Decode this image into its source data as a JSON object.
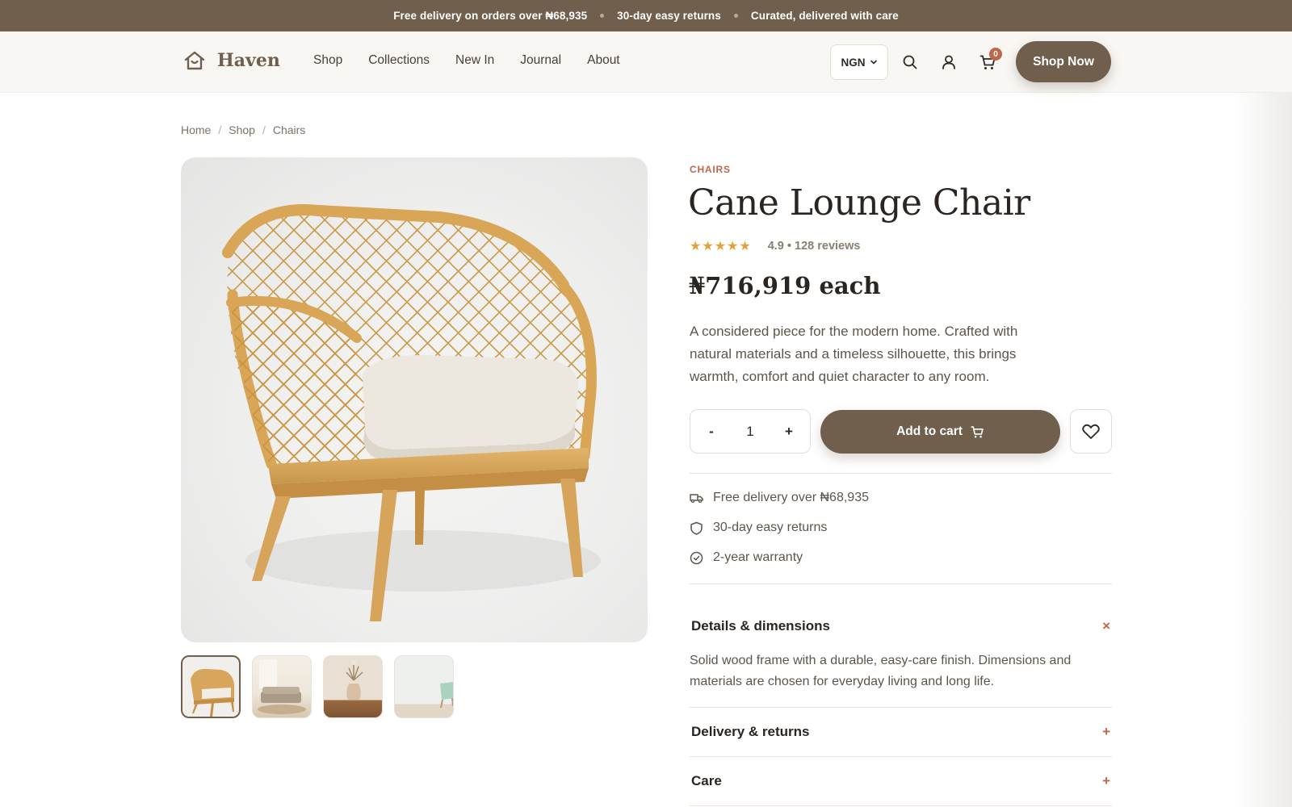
{
  "announcement": {
    "item1": "Free delivery on orders over ₦68,935",
    "item2": "30-day easy returns",
    "item3": "Curated, delivered with care"
  },
  "header": {
    "logo_text": "Haven",
    "nav": [
      "Shop",
      "Collections",
      "New In",
      "Journal",
      "About"
    ],
    "currency": "NGN",
    "cart_count": "0",
    "cta": "Shop Now"
  },
  "breadcrumb": [
    "Home",
    "Shop",
    "Chairs"
  ],
  "gallery": {
    "thumbnails": [
      "chair",
      "living-room",
      "vase",
      "mint-chair"
    ],
    "active_index": 0
  },
  "product": {
    "category": "CHAIRS",
    "title": "Cane Lounge Chair",
    "stars": "★★★★★",
    "rating_text": "4.9 • 128 reviews",
    "price": "₦716,919 each",
    "description": "A considered piece for the modern home. Crafted with natural materials and a timeless silhouette, this brings warmth, comfort and quiet character to any room.",
    "quantity": "1",
    "qty_minus": "-",
    "qty_plus": "+",
    "add_to_cart": "Add to cart"
  },
  "perks": [
    {
      "icon": "truck-icon",
      "text": "Free delivery over ₦68,935"
    },
    {
      "icon": "shield-icon",
      "text": "30-day easy returns"
    },
    {
      "icon": "check-circle-icon",
      "text": "2-year warranty"
    }
  ],
  "accordion": [
    {
      "title": "Details & dimensions",
      "toggle": "×",
      "expanded": true,
      "body": "Solid wood frame with a durable, easy-care finish. Dimensions and materials are chosen for everyday living and long life."
    },
    {
      "title": "Delivery & returns",
      "toggle": "+",
      "expanded": false
    },
    {
      "title": "Care",
      "toggle": "+",
      "expanded": false
    }
  ],
  "colors": {
    "brand": "#6f5f4c",
    "accent": "#c0674a",
    "star": "#e0a239"
  }
}
